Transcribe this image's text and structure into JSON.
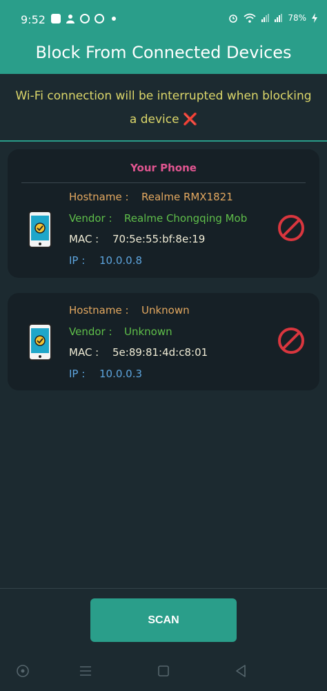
{
  "status_bar": {
    "time": "9:52",
    "battery": "78%"
  },
  "header": {
    "title": "Block From Connected Devices"
  },
  "warning": {
    "text": "Wi-Fi connection will be interrupted when blocking a device",
    "icon": "❌"
  },
  "devices": [
    {
      "card_title": "Your Phone",
      "hostname_label": "Hostname :",
      "hostname": "Realme RMX1821",
      "vendor_label": "Vendor :",
      "vendor": "Realme Chongqing Mob",
      "mac_label": "MAC :",
      "mac": "70:5e:55:bf:8e:19",
      "ip_label": "IP :",
      "ip": "10.0.0.8"
    },
    {
      "hostname_label": "Hostname :",
      "hostname": "Unknown",
      "vendor_label": "Vendor :",
      "vendor": "Unknown",
      "mac_label": "MAC :",
      "mac": "5e:89:81:4d:c8:01",
      "ip_label": "IP :",
      "ip": "10.0.0.3"
    }
  ],
  "actions": {
    "scan_label": "SCAN"
  },
  "colors": {
    "accent": "#2a9e8a",
    "background": "#1c2a30",
    "card": "#162026",
    "block_red": "#d9363e"
  }
}
